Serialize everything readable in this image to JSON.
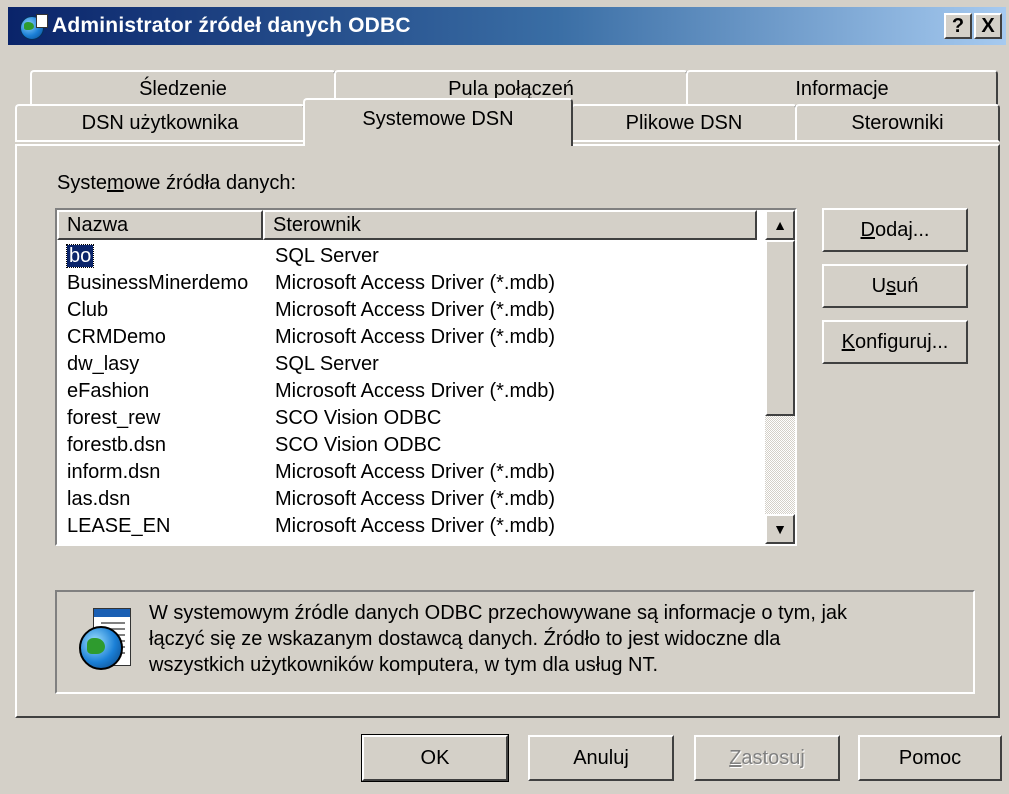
{
  "window": {
    "title": "Administrator źródeł danych ODBC",
    "help_btn": "?",
    "close_btn": "X"
  },
  "tabs": {
    "row1": [
      "Śledzenie",
      "Pula połączeń",
      "Informacje"
    ],
    "row2": [
      "DSN użytkownika",
      "Systemowe DSN",
      "Plikowe DSN",
      "Sterowniki"
    ],
    "active": "Systemowe DSN"
  },
  "section": {
    "label_pre": "Syste",
    "label_ul": "m",
    "label_post": "owe źródła danych:"
  },
  "list": {
    "col_name": "Nazwa",
    "col_driver": "Sterownik",
    "rows": [
      {
        "name": "bo",
        "driver": "SQL Server"
      },
      {
        "name": "BusinessMinerdemo",
        "driver": "Microsoft Access Driver (*.mdb)"
      },
      {
        "name": "Club",
        "driver": "Microsoft Access Driver (*.mdb)"
      },
      {
        "name": "CRMDemo",
        "driver": "Microsoft Access Driver (*.mdb)"
      },
      {
        "name": "dw_lasy",
        "driver": "SQL Server"
      },
      {
        "name": "eFashion",
        "driver": "Microsoft Access Driver (*.mdb)"
      },
      {
        "name": "forest_rew",
        "driver": "SCO Vision ODBC"
      },
      {
        "name": "forestb.dsn",
        "driver": "SCO Vision ODBC"
      },
      {
        "name": "inform.dsn",
        "driver": "Microsoft Access Driver (*.mdb)"
      },
      {
        "name": "las.dsn",
        "driver": "Microsoft Access Driver (*.mdb)"
      },
      {
        "name": "LEASE_EN",
        "driver": "Microsoft Access Driver (*.mdb)"
      }
    ]
  },
  "side_buttons": {
    "add_ul": "D",
    "add_rest": "odaj...",
    "remove_pre": "U",
    "remove_ul": "s",
    "remove_post": "uń",
    "config_ul": "K",
    "config_rest": "onfiguruj..."
  },
  "info": {
    "line1": "W systemowym źródle danych ODBC przechowywane są informacje o tym, jak",
    "line2": "łączyć się ze wskazanym dostawcą danych. Źródło to jest widoczne dla",
    "line3": "wszystkich użytkowników komputera, w tym dla usług NT."
  },
  "footer": {
    "ok": "OK",
    "cancel": "Anuluj",
    "apply_ul": "Z",
    "apply_rest": "astosuj",
    "help": "Pomoc"
  },
  "icons": {
    "title": "odbc-globe-icon",
    "info": "globe-document-icon",
    "scroll_up": "▲",
    "scroll_down": "▼"
  }
}
